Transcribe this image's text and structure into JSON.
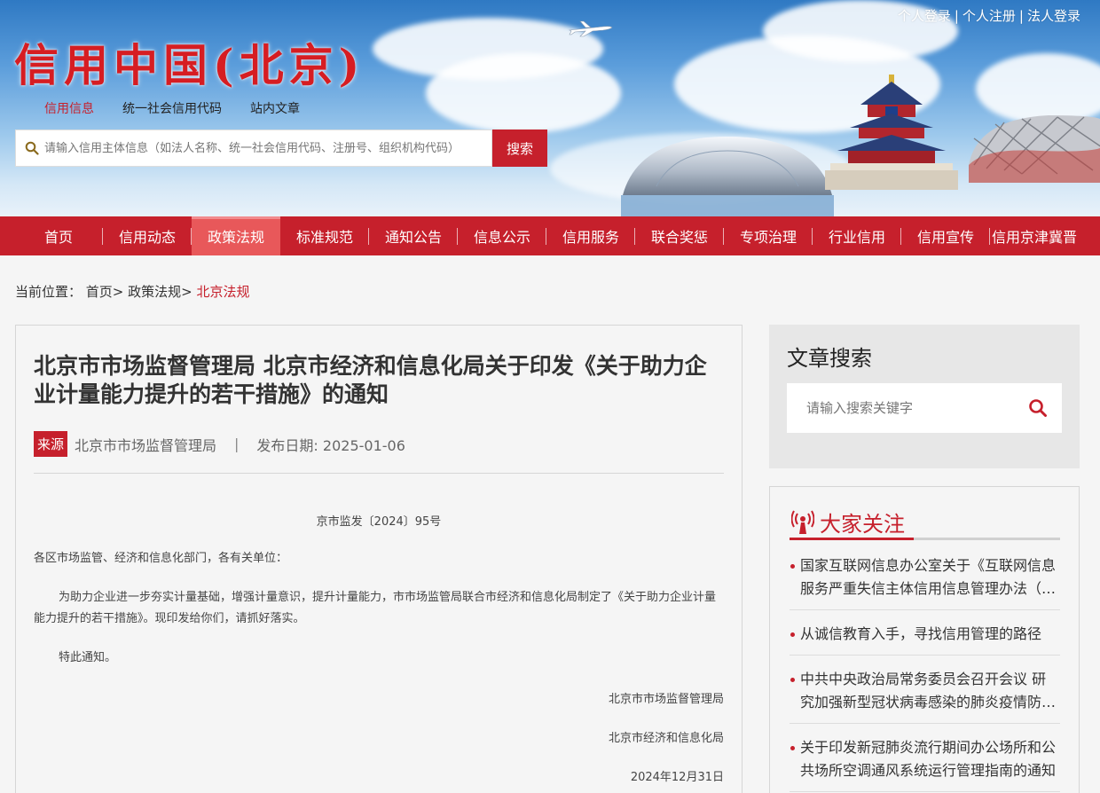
{
  "header": {
    "site_title": "信用中国(北京)",
    "top_links": [
      "个人登录",
      "个人注册",
      "法人登录"
    ],
    "search_tabs": [
      "信用信息",
      "统一社会信用代码",
      "站内文章"
    ],
    "search_placeholder": "请输入信用主体信息（如法人名称、统一社会信用代码、注册号、组织机构代码）",
    "search_button": "搜索"
  },
  "nav": {
    "items": [
      "首页",
      "信用动态",
      "政策法规",
      "标准规范",
      "通知公告",
      "信息公示",
      "信用服务",
      "联合奖惩",
      "专项治理",
      "行业信用",
      "信用宣传",
      "信用京津冀晋"
    ],
    "active_index": 2
  },
  "breadcrumb": {
    "label": "当前位置：",
    "items": [
      "首页>",
      "政策法规>",
      "北京法规"
    ]
  },
  "article": {
    "title": "北京市市场监督管理局 北京市经济和信息化局关于印发《关于助力企业计量能力提升的若干措施》的通知",
    "source_tag": "来源",
    "source": "北京市市场监督管理局",
    "date_label": "发布日期: 2025-01-06",
    "doc_no": "京市监发〔2024〕95号",
    "salutation": "各区市场监管、经济和信息化部门，各有关单位：",
    "body": "为助力企业进一步夯实计量基础，增强计量意识，提升计量能力，市市场监管局联合市经济和信息化局制定了《关于助力企业计量能力提升的若干措施》。现印发给你们，请抓好落实。",
    "closing": "特此通知。",
    "signatures": [
      "北京市市场监督管理局",
      "北京市经济和信息化局",
      "2024年12月31日"
    ]
  },
  "sidebar": {
    "search_title": "文章搜索",
    "search_placeholder": "请输入搜索关键字",
    "focus_title": "大家关注",
    "focus_items": [
      "国家互联网信息办公室关于《互联网信息服务严重失信主体信用信息管理办法（征求意见稿）》公开征求意见的通知",
      "从诚信教育入手，寻找信用管理的路径",
      "中共中央政治局常务委员会召开会议 研究加强新型冠状病毒感染的肺炎疫情防控工作",
      "关于印发新冠肺炎流行期间办公场所和公共场所空调通风系统运行管理指南的通知"
    ]
  },
  "colors": {
    "brand_red": "#c6202c",
    "nav_active": "#e8585a",
    "page_bg": "#f5f5f5"
  }
}
